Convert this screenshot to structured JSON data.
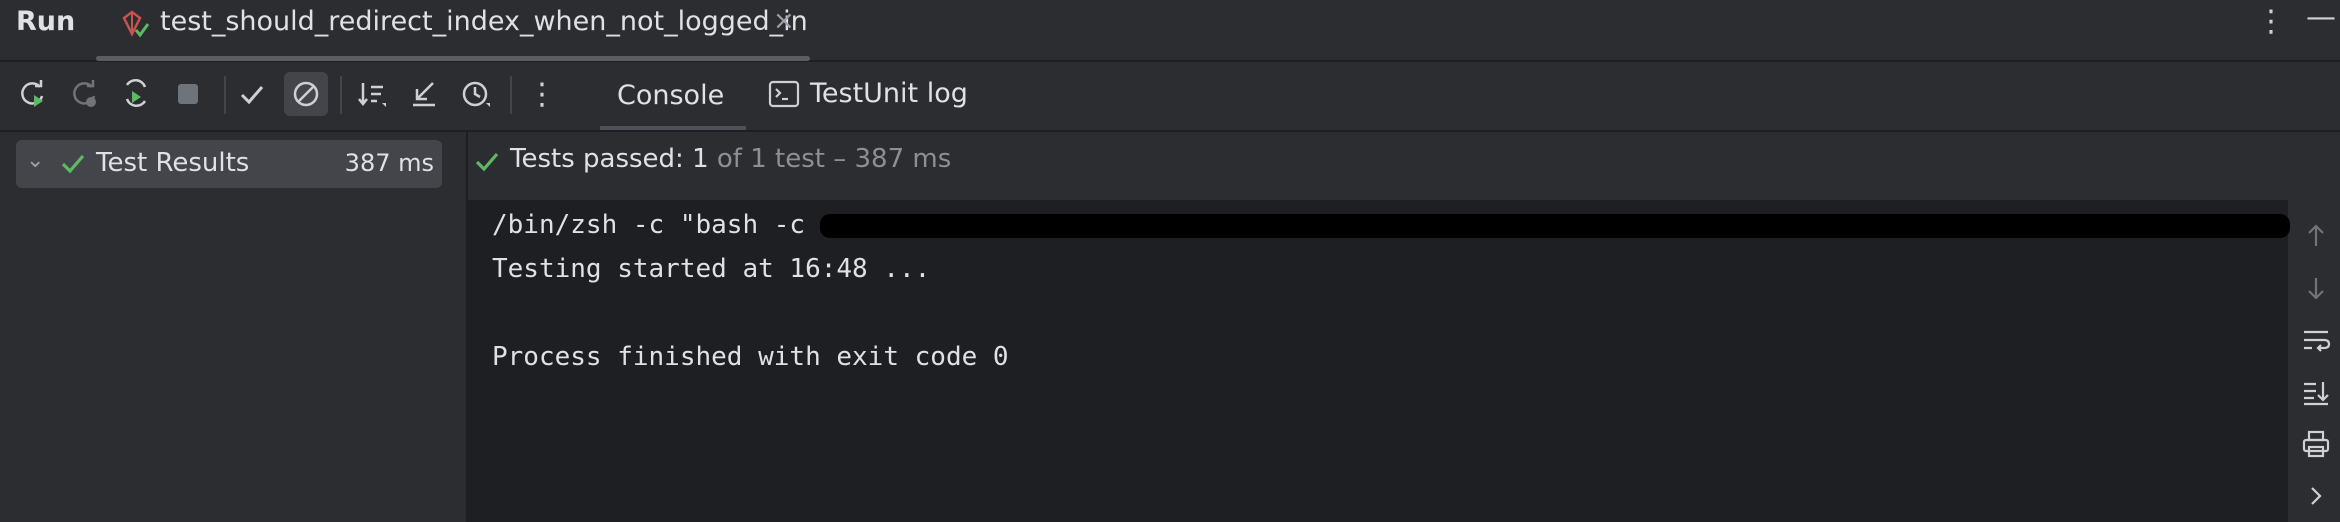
{
  "header": {
    "title": "Run",
    "tab_label": "test_should_redirect_index_when_not_logged_in",
    "tab_close": "×",
    "more_glyph": "⋮",
    "minimize_glyph": "—"
  },
  "toolbar": {
    "more_glyph": "⋮",
    "tabs": [
      "Console",
      "TestUnit log"
    ],
    "icons": [
      "rerun-icon",
      "rerun-failed-icon",
      "toggle-auto-test-icon",
      "stop-icon",
      "show-passed-icon",
      "show-ignored-icon",
      "sort-icon",
      "collapse-icon",
      "history-icon",
      "more-icon"
    ]
  },
  "tree": {
    "root_label": "Test Results",
    "root_time": "387 ms",
    "chevron": "⌄"
  },
  "status": {
    "passed_prefix": "Tests passed:",
    "passed_count": "1",
    "total": "of 1 test – 387 ms"
  },
  "console": {
    "lines": [
      "/bin/zsh -c \"bash -c",
      "Testing started at 16:48 ...",
      "",
      "Process finished with exit code 0"
    ]
  },
  "colors": {
    "success": "#5fb865",
    "background": "#2b2d30",
    "console_bg": "#1e1f22"
  }
}
